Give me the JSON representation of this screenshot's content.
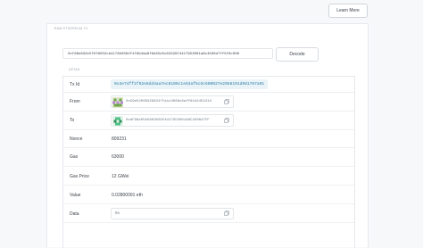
{
  "header": {
    "learn_more_label": "Learn More"
  },
  "card": {
    "title": "RAW ETHEREUM TX",
    "raw_tx": "0xf86e830c5f0f8502cb417802082f4f894da9f9e65e5c63329f4417953001a8c4506d7ff5f0c008",
    "decode_label": "Decode",
    "detail_label": "DETAIL"
  },
  "detail": {
    "txid": {
      "label": "Tx Id",
      "value": "0x3e74ff1f02e8dd4aa7ec8109c1e63af5c5c600027e2956191d981767a01"
    },
    "from": {
      "label": "From",
      "value": "0x59e520083266247fa1c3089c6aff6442452244"
    },
    "to": {
      "label": "To",
      "value": "0xAF99e05b5663029fA417953001A8C4506d7FF"
    },
    "nonce": {
      "label": "Nonce",
      "value": "809231"
    },
    "gas": {
      "label": "Gas",
      "value": "63000"
    },
    "gas_price": {
      "label": "Gas Price",
      "value": "12 GWei"
    },
    "value": {
      "label": "Value",
      "value": "0.02800091 eth"
    },
    "data": {
      "label": "Data",
      "value": "0x"
    }
  },
  "colors": {
    "accent": "#2a7da8",
    "hash_bg": "#eaf3f7",
    "from_avatar": [
      "#6fa84a",
      "#b98ad6",
      "#e0e6c8"
    ],
    "to_avatar": [
      "#4fbf84",
      "#e3f3ea",
      "#2f8f5a"
    ]
  },
  "icons": {
    "copy": "copy-icon",
    "from_avatar": "identicon",
    "to_avatar": "identicon"
  }
}
